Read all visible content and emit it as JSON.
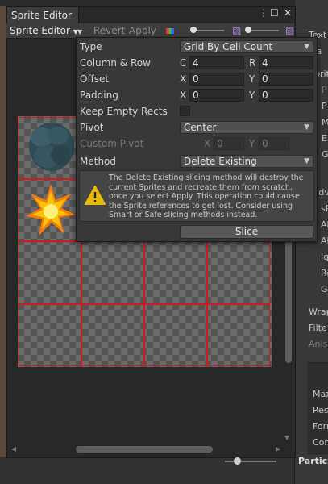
{
  "window": {
    "tab_title": "Sprite Editor",
    "mode_dropdown": "Sprite Editor",
    "revert_label": "Revert",
    "apply_label": "Apply"
  },
  "slice_popup": {
    "type_label": "Type",
    "type_value": "Grid By Cell Count",
    "column_row_label": "Column & Row",
    "column_axis": "C",
    "column_value": "4",
    "row_axis": "R",
    "row_value": "4",
    "offset_label": "Offset",
    "offset_x_axis": "X",
    "offset_x": "0",
    "offset_y_axis": "Y",
    "offset_y": "0",
    "padding_label": "Padding",
    "padding_x_axis": "X",
    "padding_x": "0",
    "padding_y_axis": "Y",
    "padding_y": "0",
    "keep_empty_label": "Keep Empty Rects",
    "keep_empty_checked": false,
    "pivot_label": "Pivot",
    "pivot_value": "Center",
    "custom_pivot_label": "Custom Pivot",
    "custom_pivot_x_axis": "X",
    "custom_pivot_x": "0",
    "custom_pivot_y_axis": "Y",
    "custom_pivot_y": "0",
    "method_label": "Method",
    "method_value": "Delete Existing",
    "warning_text": "The Delete Existing slicing method will destroy the current Sprites and recreate them from scratch, once you select Apply. This operation could cause the Sprite references to get lost. Consider using Smart or Safe slicing methods instead.",
    "slice_button": "Slice"
  },
  "inspector": {
    "items": [
      "Text",
      "Ma",
      "Sprit",
      "P",
      "P",
      "M",
      "E",
      "G",
      "Adva",
      "sR",
      "Al",
      "Al",
      "Ig",
      "Re",
      "G",
      "Wrap",
      "Filte",
      "Anis",
      "Max",
      "Res",
      "Forr",
      "Cor"
    ],
    "bottom_label": "Partic"
  },
  "colors": {
    "grid_line": "#d11a1a",
    "window_bg": "#282828",
    "popup_bg": "#383838",
    "warning_icon": "#e6b800"
  }
}
